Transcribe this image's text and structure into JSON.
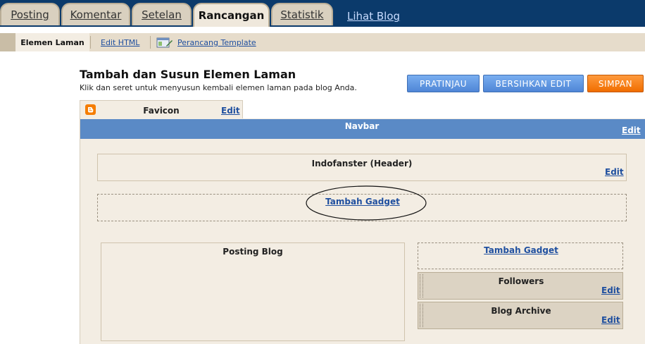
{
  "tabs": [
    {
      "label": "Posting"
    },
    {
      "label": "Komentar"
    },
    {
      "label": "Setelan"
    },
    {
      "label": "Rancangan"
    },
    {
      "label": "Statistik"
    }
  ],
  "view_blog_label": "Lihat Blog",
  "subtabs": {
    "active": "Elemen Laman",
    "edit_html": "Edit HTML",
    "template_designer": "Perancang Template"
  },
  "page": {
    "title": "Tambah dan Susun Elemen Laman",
    "subtitle": "Klik dan seret untuk menyusun kembali elemen laman pada blog Anda."
  },
  "buttons": {
    "preview": "PRATINJAU",
    "clear": "BERSIHKAN EDIT",
    "save": "SIMPAN"
  },
  "favicon": {
    "label": "Favicon",
    "edit": "Edit"
  },
  "navbar": {
    "label": "Navbar",
    "edit": "Edit"
  },
  "header": {
    "label": "Indofanster (Header)",
    "edit": "Edit"
  },
  "add_gadget_label": "Tambah Gadget",
  "main": {
    "label": "Posting Blog"
  },
  "sidebar": {
    "add_gadget_label": "Tambah Gadget",
    "widgets": [
      {
        "label": "Followers",
        "edit": "Edit"
      },
      {
        "label": "Blog Archive",
        "edit": "Edit"
      }
    ]
  },
  "colors": {
    "topbar": "#0b3a6b",
    "navbar": "#5a8ac6",
    "save": "#f06d00",
    "accent_blue": "#4f86d6"
  }
}
